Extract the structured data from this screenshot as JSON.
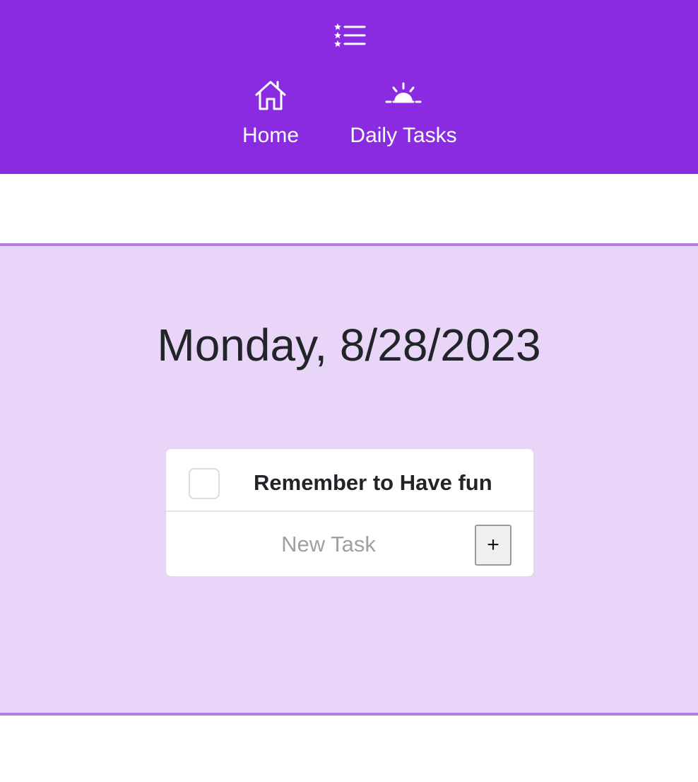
{
  "navbar": {
    "background": "#8a2be2",
    "brand_icon": "starred-list-icon",
    "items": [
      {
        "label": "Home",
        "icon": "house-icon"
      },
      {
        "label": "Daily Tasks",
        "icon": "sunrise-icon"
      }
    ]
  },
  "main": {
    "background": "#e8d5f7",
    "accent_border": "#b07ee6",
    "date_heading": "Monday, 8/28/2023",
    "tasks": [
      {
        "text": "Remember to Have fun",
        "checked": false
      }
    ],
    "new_task": {
      "placeholder": "New Task",
      "value": "",
      "add_label": "+"
    }
  }
}
